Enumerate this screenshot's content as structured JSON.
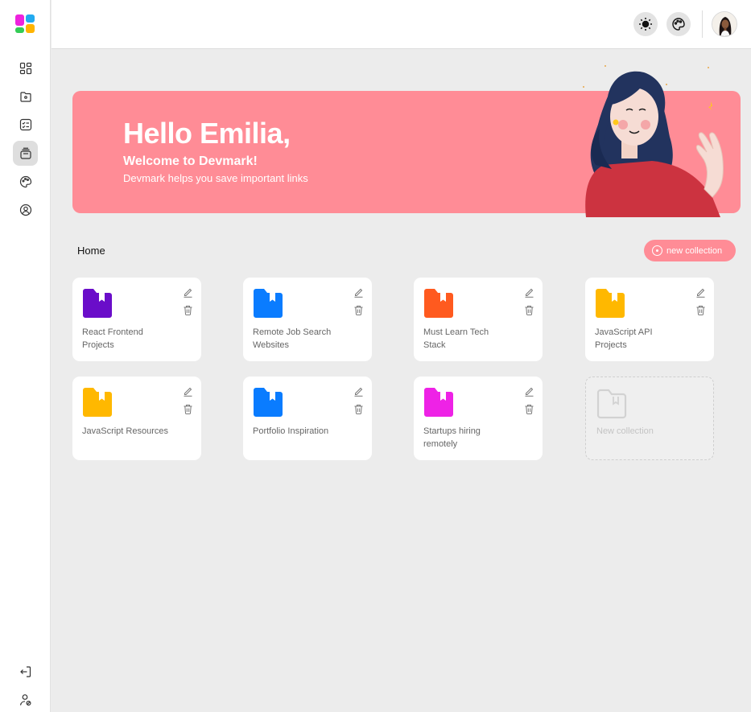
{
  "sidebar": {
    "items": [
      {
        "icon": "dashboard-icon",
        "active": false
      },
      {
        "icon": "folder-icon",
        "active": false
      },
      {
        "icon": "checklist-icon",
        "active": false
      },
      {
        "icon": "collections-icon",
        "active": true
      },
      {
        "icon": "palette-icon",
        "active": false
      },
      {
        "icon": "profile-icon",
        "active": false
      }
    ],
    "bottom": [
      {
        "icon": "logout-icon"
      },
      {
        "icon": "user-settings-icon"
      }
    ]
  },
  "topbar": {
    "theme_icon": "sun-icon",
    "palette_icon": "palette-icon"
  },
  "banner": {
    "greeting": "Hello Emilia,",
    "welcome": "Welcome to Devmark!",
    "subtitle": "Devmark helps you save important links",
    "color": "#ff8c96"
  },
  "section": {
    "title": "Home",
    "new_button_label": "new collection"
  },
  "collections": [
    {
      "title": "React Frontend Projects",
      "color": "#6a0dc9"
    },
    {
      "title": "Remote Job Search Websites",
      "color": "#0a7cff"
    },
    {
      "title": "Must Learn Tech Stack",
      "color": "#ff5a1f"
    },
    {
      "title": "JavaScript API Projects",
      "color": "#ffb800"
    },
    {
      "title": "JavaScript Resources",
      "color": "#ffb800"
    },
    {
      "title": "Portfolio Inspiration",
      "color": "#0a7cff"
    },
    {
      "title": "Startups hiring remotely",
      "color": "#ee22e6"
    }
  ],
  "new_card": {
    "label": "New collection"
  }
}
